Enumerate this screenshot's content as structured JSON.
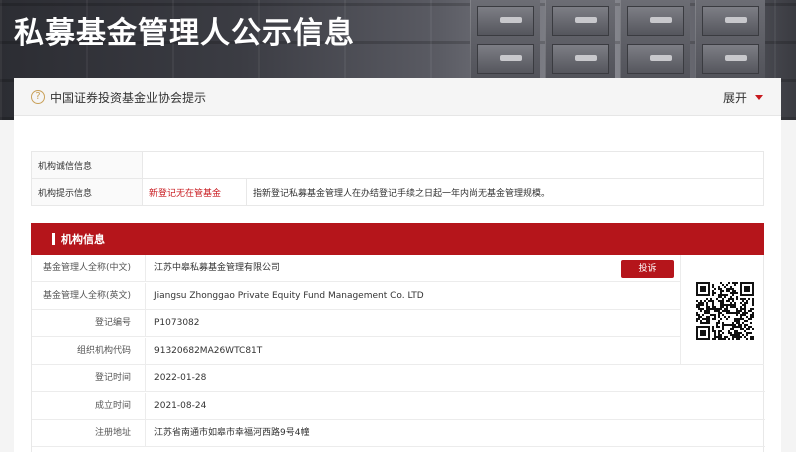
{
  "banner": {
    "title": "私募基金管理人公示信息"
  },
  "notice": {
    "icon": "question-circle-icon",
    "text": "中国证券投资基金业协会提示",
    "expand_label": "展开"
  },
  "credit": {
    "rows": [
      {
        "label": "机构诚信信息",
        "tag": "",
        "desc": ""
      },
      {
        "label": "机构提示信息",
        "tag": "新登记无在管基金",
        "desc": "指新登记私募基金管理人在办结登记手续之日起一年内尚无基金管理规模。"
      }
    ]
  },
  "section": {
    "title": "机构信息"
  },
  "info": {
    "complain_label": "投诉",
    "rows": [
      {
        "label": "基金管理人全称(中文)",
        "value": "江苏中皋私募基金管理有限公司"
      },
      {
        "label": "基金管理人全称(英文)",
        "value": "Jiangsu Zhonggao Private Equity Fund Management Co. LTD"
      },
      {
        "label": "登记编号",
        "value": "P1073082"
      },
      {
        "label": "组织机构代码",
        "value": "91320682MA26WTC81T"
      },
      {
        "label": "登记时间",
        "value": "2022-01-28"
      },
      {
        "label": "成立时间",
        "value": "2021-08-24"
      },
      {
        "label": "注册地址",
        "value": "江苏省南通市如皋市幸福河西路9号4幢"
      }
    ]
  },
  "colors": {
    "brand_red": "#b5151b",
    "tag_red": "#c8191e"
  }
}
